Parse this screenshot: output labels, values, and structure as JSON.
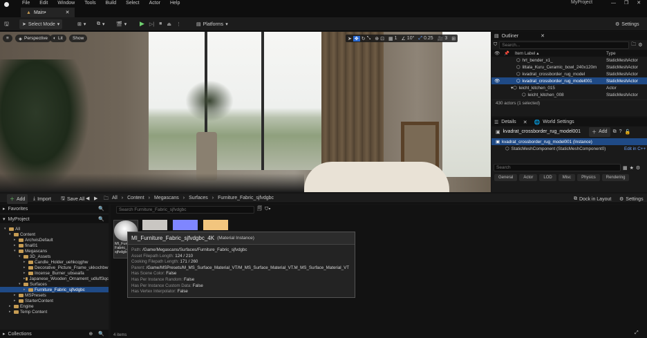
{
  "app": {
    "project_name": "MyProject"
  },
  "menu": [
    "File",
    "Edit",
    "Window",
    "Tools",
    "Build",
    "Select",
    "Actor",
    "Help"
  ],
  "tab": {
    "label": "Main•"
  },
  "toolbar": {
    "select_mode": "Select Mode",
    "platforms": "Platforms",
    "settings": "Settings"
  },
  "viewport": {
    "perspective": "Perspective",
    "lit": "Lit",
    "show": "Show",
    "grid_snap": "1",
    "angle_snap": "10°",
    "scale_snap": "0.25",
    "camera_speed": "3"
  },
  "outliner": {
    "title": "Outliner",
    "search_placeholder": "Search...",
    "col_label": "Item Label",
    "col_type": "Type",
    "rows": [
      {
        "label": "hrt_bender_x1_",
        "type": "StaticMeshActor",
        "indent": 2,
        "selected": false
      },
      {
        "label": "littala_Kuru_Ceramic_bowl_240x120m",
        "type": "StaticMeshActor",
        "indent": 2,
        "selected": false
      },
      {
        "label": "kvadrat_crossborder_rug_model",
        "type": "StaticMeshActor",
        "indent": 2,
        "selected": false
      },
      {
        "label": "kvadrat_crossborder_rug_model001",
        "type": "StaticMeshActor",
        "indent": 2,
        "selected": true
      },
      {
        "label": "leicht_kitchen_015",
        "type": "Actor",
        "indent": 1,
        "selected": false
      },
      {
        "label": "leicht_kitchen_008",
        "type": "StaticMeshActor",
        "indent": 3,
        "selected": false
      }
    ],
    "status": "430 actors (1 selected)"
  },
  "details": {
    "title": "Details",
    "world_settings": "World Settings",
    "actor_name": "kvadrat_crossborder_rug_model001",
    "add_label": "Add",
    "instance_label": "kvadrat_crossborder_rug_model001 (Instance)",
    "component_label": "StaticMeshComponent (StaticMeshComponent0)",
    "edit_cpp": "Edit in C++",
    "search_placeholder": "Search",
    "filters": [
      "General",
      "Actor",
      "LOD",
      "Misc",
      "Physics",
      "Rendering"
    ]
  },
  "content_browser": {
    "add": "Add",
    "import": "Import",
    "save_all": "Save All",
    "breadcrumb": [
      "All",
      "Content",
      "Megascans",
      "Surfaces",
      "Furniture_Fabric_sjfvdgbc"
    ],
    "dock_in_layout": "Dock in Layout",
    "settings": "Settings",
    "favorites": "Favorites",
    "project": "MyProject",
    "search_placeholder": "Search Furniture_Fabric_sjfvdgbc",
    "tree": [
      {
        "label": "All",
        "depth": 0,
        "open": true,
        "selected": false
      },
      {
        "label": "Content",
        "depth": 1,
        "open": true,
        "selected": false
      },
      {
        "label": "ArchvisDefault",
        "depth": 2,
        "open": false,
        "selected": false
      },
      {
        "label": "final01",
        "depth": 2,
        "open": false,
        "selected": false
      },
      {
        "label": "Megascans",
        "depth": 2,
        "open": true,
        "selected": false
      },
      {
        "label": "3D_Assets",
        "depth": 3,
        "open": true,
        "selected": false
      },
      {
        "label": "Candle_Holder_uehkcqghw",
        "depth": 4,
        "open": false,
        "selected": false
      },
      {
        "label": "Decorative_Picture_Frame_ukkochbw",
        "depth": 4,
        "open": false,
        "selected": false
      },
      {
        "label": "Incense_Burner_ubseaifa",
        "depth": 4,
        "open": false,
        "selected": false
      },
      {
        "label": "Japanese_Wooden_Ornament_udluff3qc",
        "depth": 4,
        "open": false,
        "selected": false
      },
      {
        "label": "Surfaces",
        "depth": 3,
        "open": true,
        "selected": false
      },
      {
        "label": "Furniture_Fabric_sjfvdgbc",
        "depth": 4,
        "open": false,
        "selected": true
      },
      {
        "label": "MSPresets",
        "depth": 2,
        "open": false,
        "selected": false
      },
      {
        "label": "StarterContent",
        "depth": 2,
        "open": false,
        "selected": false
      },
      {
        "label": "Engine",
        "depth": 1,
        "open": false,
        "selected": false
      },
      {
        "label": "Temp Content",
        "depth": 1,
        "open": false,
        "selected": false
      }
    ],
    "asset_caption": "MI_Furn Fabric_ sjfvdgb",
    "swatch_colors": [
      "#c9c6c2",
      "#7f86ff",
      "#f2c57e"
    ],
    "collections": "Collections",
    "item_count": "4 items"
  },
  "tooltip": {
    "title": "MI_Furniture_Fabric_sjfvdgbc_4K",
    "subtitle": "(Material Instance)",
    "lines": [
      {
        "key": "Path: ",
        "value": "/Game/Megascans/Surfaces/Furniture_Fabric_sjfvdgbc"
      },
      {
        "key": "Asset Filepath Length: ",
        "value": "124 / 210"
      },
      {
        "key": "Cooking Filepath Length: ",
        "value": "171 / 260"
      },
      {
        "key": "Parent: ",
        "value": "/Game/MSPresets/M_MS_Surface_Material_VT/M_MS_Surface_Material_VT.M_MS_Surface_Material_VT"
      },
      {
        "key": "Has Scene Color: ",
        "value": "False"
      },
      {
        "key": "Has Per Instance Random: ",
        "value": "False"
      },
      {
        "key": "Has Per Instance Custom Data: ",
        "value": "False"
      },
      {
        "key": "Has Vertex Interpolator: ",
        "value": "False"
      }
    ]
  }
}
